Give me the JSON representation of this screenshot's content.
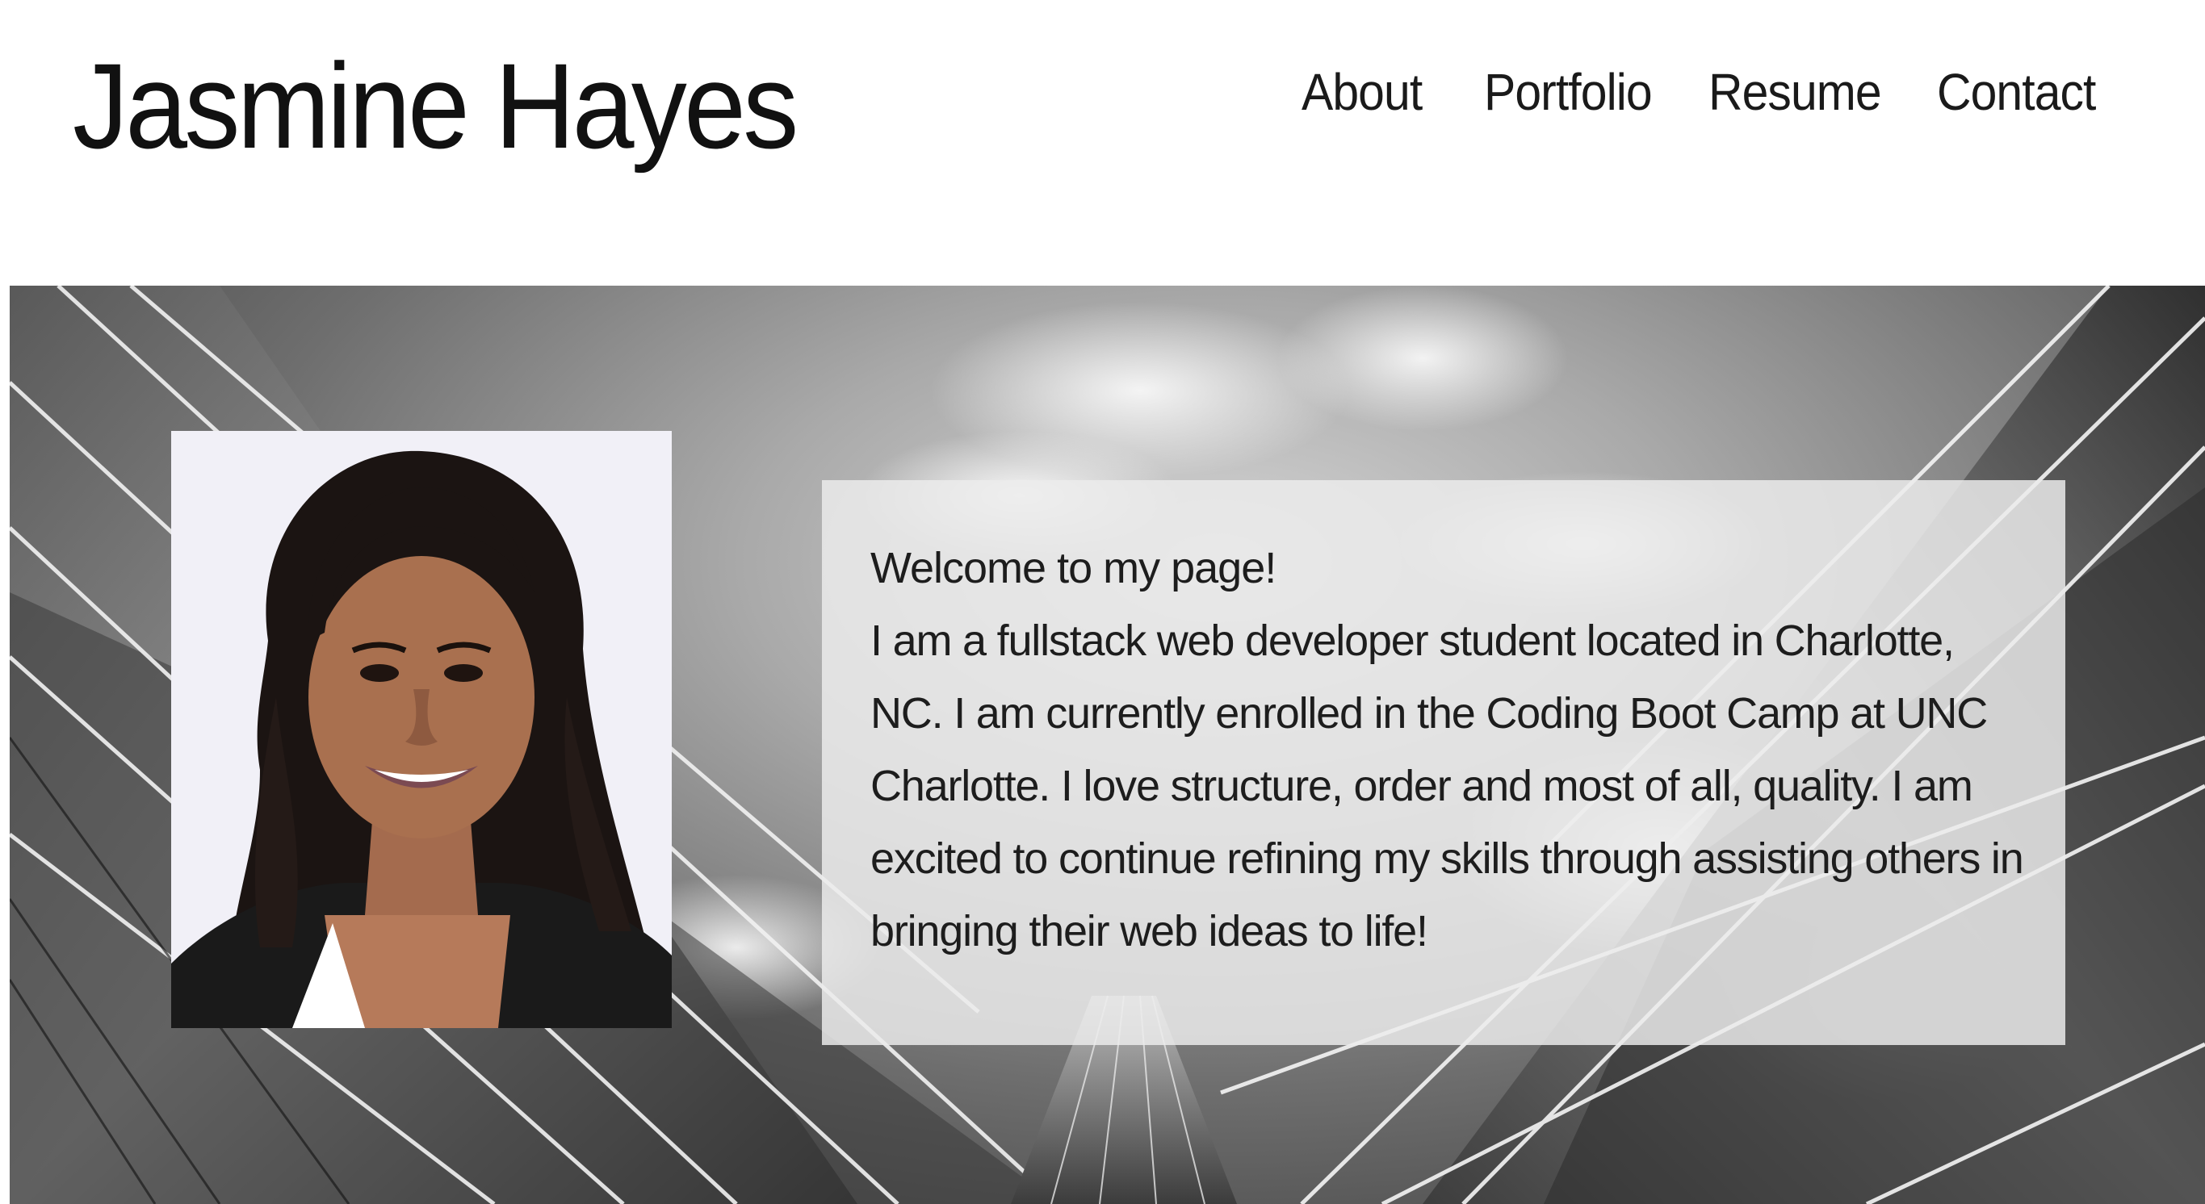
{
  "header": {
    "site_title": "Jasmine Hayes",
    "nav": [
      {
        "label": "About"
      },
      {
        "label": "Portfolio"
      },
      {
        "label": "Resume"
      },
      {
        "label": "Contact"
      }
    ]
  },
  "hero": {
    "background_icon": "glass-skyscraper-photo",
    "portrait_icon": "profile-photo",
    "intro": {
      "heading": "Welcome to my page!",
      "body": "I am a fullstack web developer student located in Charlotte, NC. I am currently enrolled in the Coding Boot Camp at UNC Charlotte. I love structure, order and most of all, quality. I am excited to continue refining my skills through assisting others in bringing their web ideas to life!"
    }
  }
}
